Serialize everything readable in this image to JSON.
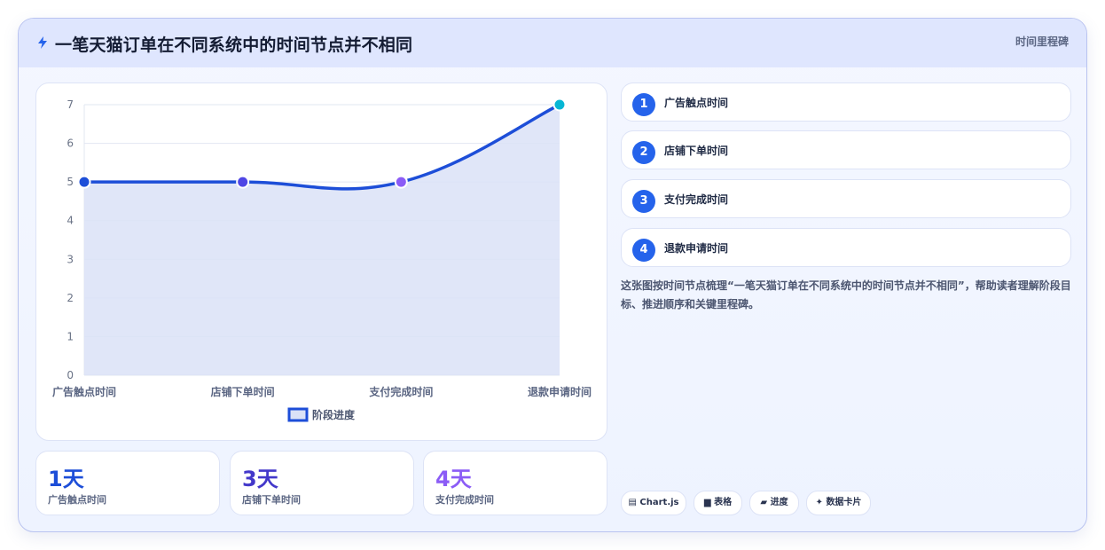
{
  "header": {
    "title": "一笔天猫订单在不同系统中的时间节点并不相同",
    "tag": "时间里程碑"
  },
  "chart_data": {
    "type": "line",
    "categories": [
      "广告触点时间",
      "店铺下单时间",
      "支付完成时间",
      "退款申请时间"
    ],
    "series": [
      {
        "name": "阶段进度",
        "values": [
          5,
          5,
          5,
          7
        ]
      }
    ],
    "ylim": [
      0,
      7
    ],
    "yticks": [
      "0",
      "1",
      "2",
      "3",
      "4",
      "5",
      "6",
      "7"
    ],
    "fill": true,
    "grid": true,
    "legend": "bottom",
    "colors": {
      "line": "#1d4ed8",
      "fill": "#dbe2f7",
      "points": [
        "#1d4ed8",
        "#4f46e5",
        "#8b5cf6",
        "#06b6d4"
      ]
    }
  },
  "stats": [
    {
      "value": "1天",
      "label": "广告触点时间",
      "color": "#1d4ed8"
    },
    {
      "value": "3天",
      "label": "店铺下单时间",
      "color": "#4338ca"
    },
    {
      "value": "4天",
      "label": "支付完成时间",
      "color": "#8b5cf6"
    }
  ],
  "steps": [
    {
      "num": "1",
      "label": "广告触点时间"
    },
    {
      "num": "2",
      "label": "店铺下单时间"
    },
    {
      "num": "3",
      "label": "支付完成时间"
    },
    {
      "num": "4",
      "label": "退款申请时间"
    }
  ],
  "description": "这张图按时间节点梳理“一笔天猫订单在不同系统中的时间节点并不相同”，帮助读者理解阶段目标、推进顺序和关键里程碑。",
  "tags": [
    {
      "icon": "▤",
      "label": "Chart.js"
    },
    {
      "icon": "▆",
      "label": "表格"
    },
    {
      "icon": "▰",
      "label": "进度"
    },
    {
      "icon": "✦",
      "label": "数据卡片"
    }
  ]
}
